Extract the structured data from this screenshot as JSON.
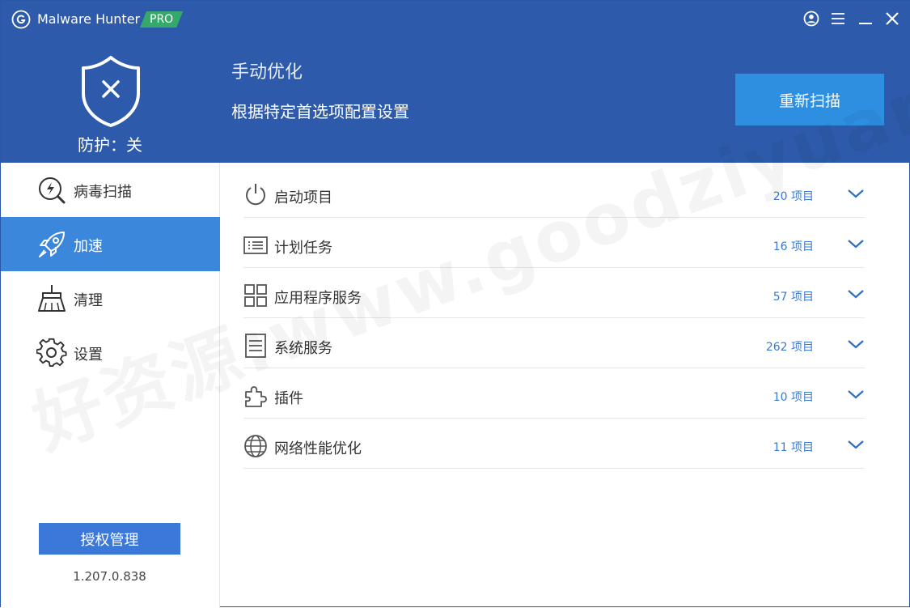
{
  "app": {
    "name": "Malware Hunter",
    "badge": "PRO",
    "logo_icon": "g-shield-logo-icon"
  },
  "window_controls": [
    "account-icon",
    "menu-icon",
    "minimize-icon",
    "close-icon"
  ],
  "header": {
    "protection_label": "防护：关",
    "protection_icon": "shield-x-icon",
    "mode_title": "手动优化",
    "mode_subtitle": "根据特定首选项配置设置",
    "rescan_button": "重新扫描"
  },
  "sidebar": {
    "items": [
      {
        "label": "病毒扫描",
        "icon": "scan-lightning-icon",
        "active": false
      },
      {
        "label": "加速",
        "icon": "rocket-icon",
        "active": true
      },
      {
        "label": "清理",
        "icon": "broom-icon",
        "active": false
      },
      {
        "label": "设置",
        "icon": "gear-icon",
        "active": false
      }
    ],
    "license_button": "授权管理",
    "version": "1.207.0.838"
  },
  "main": {
    "rows": [
      {
        "label": "启动项目",
        "count": "20 项目",
        "icon": "power-icon"
      },
      {
        "label": "计划任务",
        "count": "16 项目",
        "icon": "task-list-icon"
      },
      {
        "label": "应用程序服务",
        "count": "57 项目",
        "icon": "app-grid-icon"
      },
      {
        "label": "系统服务",
        "count": "262 项目",
        "icon": "document-list-icon"
      },
      {
        "label": "插件",
        "count": "10 项目",
        "icon": "puzzle-icon"
      },
      {
        "label": "网络性能优化",
        "count": "11 项目",
        "icon": "globe-icon"
      }
    ]
  },
  "watermark": "好资源:www.goodziyuan.com",
  "colors": {
    "header_bg": "#2d5aaa",
    "accent": "#2e8fe0",
    "active_nav": "#3b87dc",
    "badge": "#35a86b",
    "count_text": "#3a7ad2"
  }
}
